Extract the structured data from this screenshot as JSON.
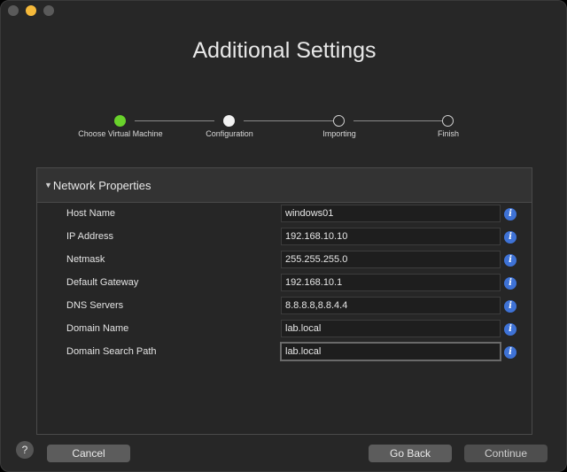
{
  "window": {
    "title": "Additional Settings"
  },
  "stepper": {
    "steps": [
      {
        "label": "Choose Virtual Machine",
        "state": "done"
      },
      {
        "label": "Configuration",
        "state": "current"
      },
      {
        "label": "Importing",
        "state": "pending"
      },
      {
        "label": "Finish",
        "state": "pending"
      }
    ],
    "colors": {
      "done": "#69d22b",
      "current": "#f2f2f2"
    }
  },
  "panel": {
    "header": "Network Properties",
    "rows": [
      {
        "label": "Host Name",
        "value": "windows01"
      },
      {
        "label": "IP Address",
        "value": "192.168.10.10"
      },
      {
        "label": "Netmask",
        "value": "255.255.255.0"
      },
      {
        "label": "Default Gateway",
        "value": "192.168.10.1"
      },
      {
        "label": "DNS Servers",
        "value": "8.8.8.8,8.8.4.4"
      },
      {
        "label": "Domain Name",
        "value": "lab.local"
      },
      {
        "label": "Domain Search Path",
        "value": "lab.local"
      }
    ],
    "info_icon": "info-icon",
    "info_glyph": "i"
  },
  "buttons": {
    "help": "?",
    "cancel": "Cancel",
    "go_back": "Go Back",
    "continue": "Continue"
  }
}
